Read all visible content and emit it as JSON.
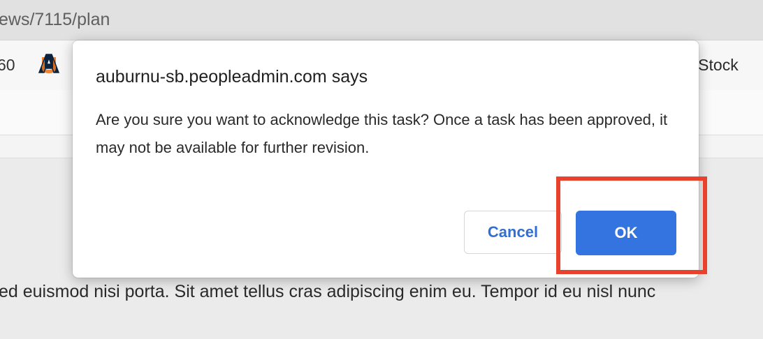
{
  "browser": {
    "url_fragment": "ews/7115/plan",
    "bookmarks": {
      "left_fragment": "60",
      "logo_icon": "auburn-au-logo",
      "right_fragment": "e Stock"
    }
  },
  "page": {
    "body_text": "ed euismod nisi porta. Sit amet tellus cras adipiscing enim eu. Tempor id eu nisl nunc"
  },
  "dialog": {
    "title": "auburnu-sb.peopleadmin.com says",
    "message": "Are you sure you want to acknowledge this task? Once a task has been approved, it may not be available for further revision.",
    "cancel_label": "Cancel",
    "ok_label": "OK"
  },
  "colors": {
    "accent": "#3374e0",
    "cancel_text": "#2f6fd6",
    "highlight": "#e8412c",
    "auburn_navy": "#0c2340",
    "auburn_orange": "#e87722"
  }
}
